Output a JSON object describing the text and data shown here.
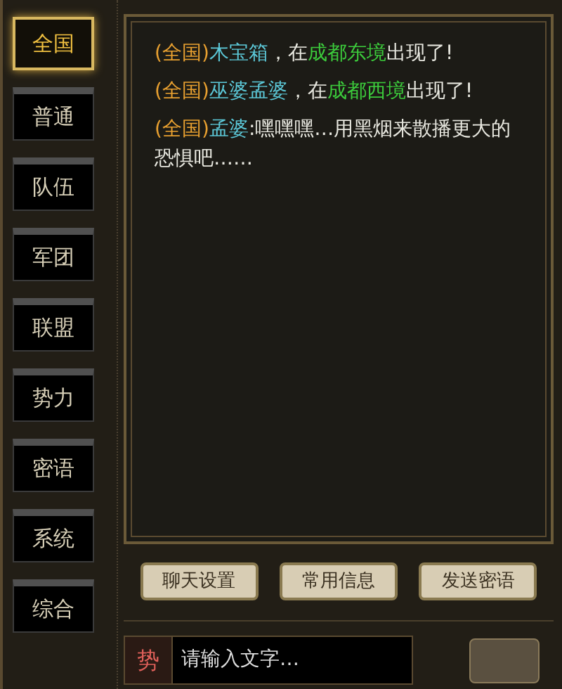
{
  "channel_tabs": [
    {
      "label": "全国",
      "selected": true
    },
    {
      "label": "普通",
      "selected": false
    },
    {
      "label": "队伍",
      "selected": false
    },
    {
      "label": "军团",
      "selected": false
    },
    {
      "label": "联盟",
      "selected": false
    },
    {
      "label": "势力",
      "selected": false
    },
    {
      "label": "密语",
      "selected": false
    },
    {
      "label": "系统",
      "selected": false
    },
    {
      "label": "综合",
      "selected": false
    }
  ],
  "messages": [
    {
      "segments": [
        {
          "kind": "channel",
          "text": "(全国)"
        },
        {
          "kind": "name",
          "text": "木宝箱"
        },
        {
          "kind": "text",
          "text": "，在"
        },
        {
          "kind": "place",
          "text": "成都东境"
        },
        {
          "kind": "text",
          "text": "出现了!"
        }
      ]
    },
    {
      "segments": [
        {
          "kind": "channel",
          "text": "(全国)"
        },
        {
          "kind": "name",
          "text": "巫婆孟婆"
        },
        {
          "kind": "text",
          "text": "，在"
        },
        {
          "kind": "place",
          "text": "成都西境"
        },
        {
          "kind": "text",
          "text": "出现了!"
        }
      ]
    },
    {
      "segments": [
        {
          "kind": "channel",
          "text": "(全国)"
        },
        {
          "kind": "name",
          "text": "孟婆"
        },
        {
          "kind": "text",
          "text": ":嘿嘿嘿…用黑烟来散播更大的恐惧吧……"
        }
      ]
    }
  ],
  "buttons": [
    "聊天设置",
    "常用信息",
    "发送密语"
  ],
  "input": {
    "channel": "势",
    "placeholder": "请输入文字…"
  }
}
